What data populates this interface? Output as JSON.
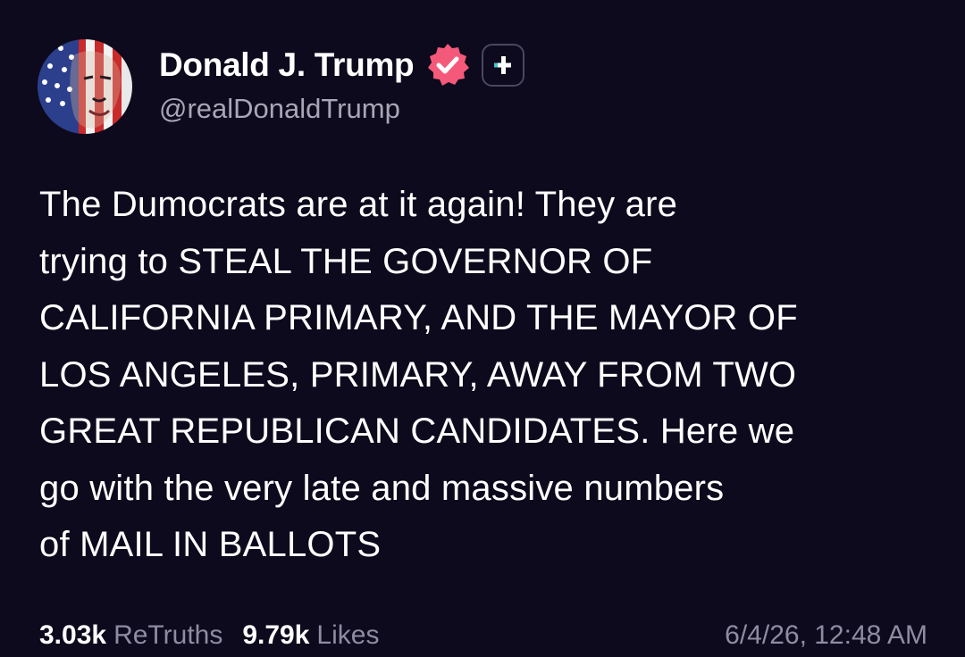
{
  "author": {
    "display_name": "Donald J. Trump",
    "handle": "@realDonaldTrump",
    "avatar_icon": "flag-portrait-avatar",
    "verified_icon": "verified-badge-icon",
    "plus_icon": "plus-badge-icon"
  },
  "post": {
    "text": "The Dumocrats are at it again! They are\ntrying to STEAL THE GOVERNOR OF\nCALIFORNIA PRIMARY, AND THE MAYOR OF\nLOS ANGELES, PRIMARY, AWAY FROM TWO\nGREAT REPUBLICAN CANDIDATES. Here we\ngo with the very late and massive numbers\nof MAIL IN BALLOTS"
  },
  "stats": {
    "retruths_count": "3.03k",
    "retruths_label": "ReTruths",
    "likes_count": "9.79k",
    "likes_label": "Likes",
    "timestamp": "6/4/26, 12:48 AM"
  },
  "colors": {
    "background": "#0c0a1c",
    "verified": "#f5597a",
    "accent": "#3fc7d1",
    "muted_text": "#8f8ba1"
  }
}
